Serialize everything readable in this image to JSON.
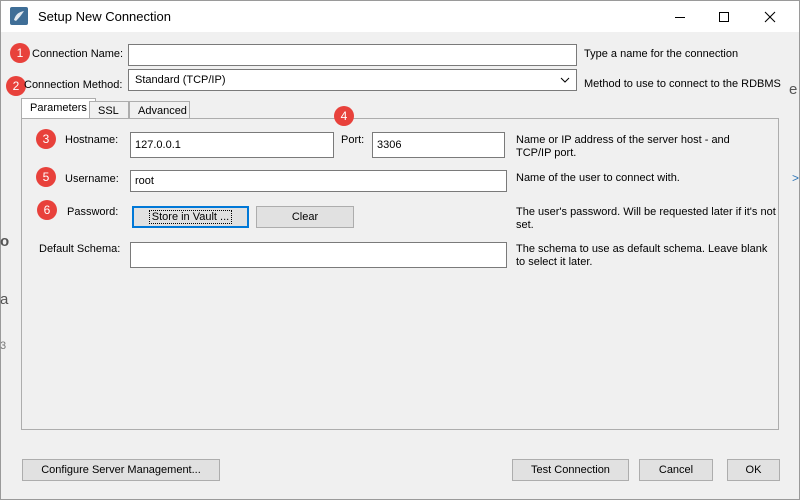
{
  "window": {
    "title": "Setup New Connection",
    "controls": [
      "minimize-icon",
      "maximize-icon",
      "close-icon"
    ],
    "app_icon": "mysql-workbench-icon"
  },
  "background_fragments": [
    "o",
    "a",
    "3",
    "e",
    ">"
  ],
  "connection_name": {
    "badge": "1",
    "label": "Connection Name:",
    "value": "",
    "hint": "Type a name for the connection"
  },
  "connection_method": {
    "badge": "2",
    "label": "Connection Method:",
    "value": "Standard (TCP/IP)",
    "hint": "Method to use to connect to the RDBMS"
  },
  "tabs": [
    {
      "label": "Parameters",
      "active": true
    },
    {
      "label": "SSL",
      "active": false
    },
    {
      "label": "Advanced",
      "active": false
    }
  ],
  "parameters": {
    "hostname": {
      "badge": "3",
      "label": "Hostname:",
      "value": "127.0.0.1"
    },
    "port": {
      "badge": "4",
      "label": "Port:",
      "value": "3306"
    },
    "host_hint": "Name or IP address of the server host - and TCP/IP port.",
    "username": {
      "badge": "5",
      "label": "Username:",
      "value": "root",
      "hint": "Name of the user to connect with."
    },
    "password": {
      "badge": "6",
      "label": "Password:",
      "store_button": "Store in Vault ...",
      "clear_button": "Clear",
      "hint": "The user's password. Will be requested later if it's not set."
    },
    "default_schema": {
      "label": "Default Schema:",
      "value": "",
      "hint": "The schema to use as default schema. Leave blank to select it later."
    }
  },
  "footer": {
    "configure_button": "Configure Server Management...",
    "test_button": "Test Connection",
    "cancel_button": "Cancel",
    "ok_button": "OK"
  },
  "colors": {
    "badge": "#e8413b",
    "focus": "#0078d7",
    "app_icon": "#3f6e97"
  }
}
